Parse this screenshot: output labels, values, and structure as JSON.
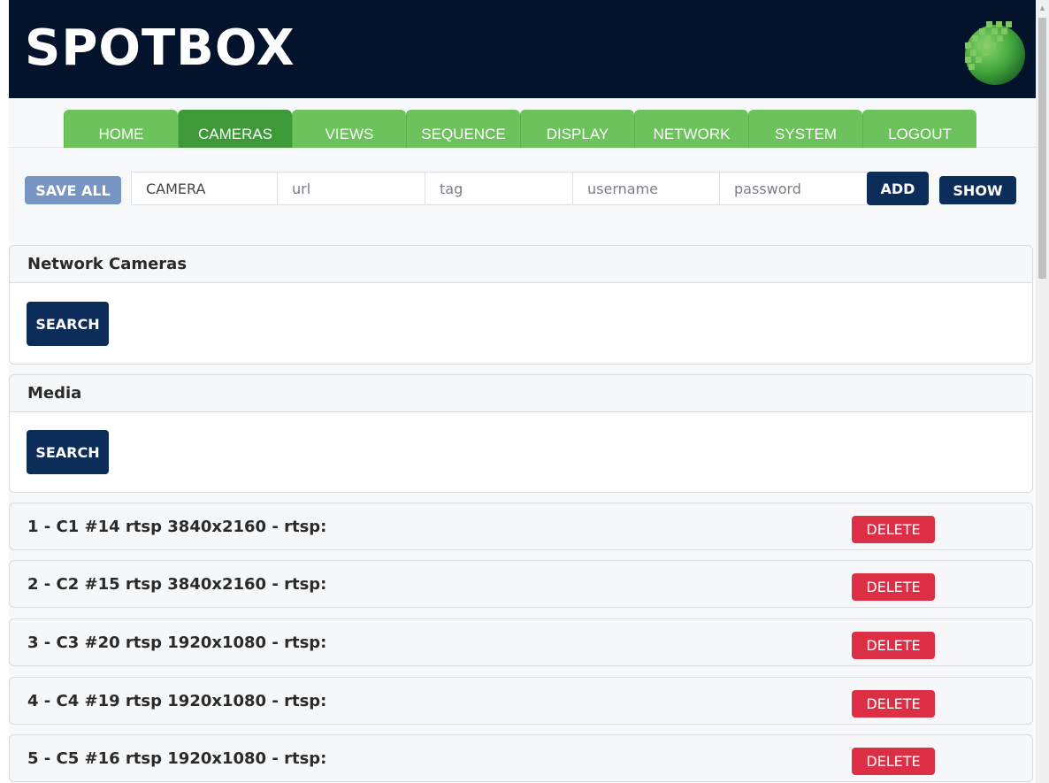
{
  "header": {
    "brand": "SPOTBOX"
  },
  "nav": {
    "tabs": [
      "HOME",
      "CAMERAS",
      "VIEWS",
      "SEQUENCE",
      "DISPLAY",
      "NETWORK",
      "SYSTEM",
      "LOGOUT"
    ],
    "active": "CAMERAS"
  },
  "toolbar": {
    "save_all_label": "SAVE ALL",
    "camera_value": "CAMERA",
    "url_placeholder": "url",
    "tag_placeholder": "tag",
    "username_placeholder": "username",
    "password_placeholder": "password",
    "add_label": "ADD",
    "show_label": "SHOW"
  },
  "network_cameras": {
    "title": "Network Cameras",
    "search_label": "SEARCH"
  },
  "media": {
    "title": "Media",
    "search_label": "SEARCH"
  },
  "cameras": [
    {
      "label": "1 - C1 #14 rtsp 3840x2160 - rtsp:",
      "delete_label": "DELETE"
    },
    {
      "label": "2 - C2 #15 rtsp 3840x2160 - rtsp:",
      "delete_label": "DELETE"
    },
    {
      "label": "3 - C3 #20 rtsp 1920x1080 - rtsp:",
      "delete_label": "DELETE"
    },
    {
      "label": "4 - C4 #19 rtsp 1920x1080 - rtsp:",
      "delete_label": "DELETE"
    },
    {
      "label": "5 - C5 #16 rtsp 1920x1080 - rtsp:",
      "delete_label": "DELETE"
    }
  ],
  "colors": {
    "header_bg": "#03132b",
    "tab_green": "#6cc35c",
    "tab_active": "#3e9a38",
    "primary_button": "#0c2c5a",
    "save_button": "#7695c2",
    "delete_button": "#dc2f45"
  },
  "icons": {
    "logo": "spotbox-logo-icon",
    "scroll_up": "scroll-up-arrow-icon"
  }
}
